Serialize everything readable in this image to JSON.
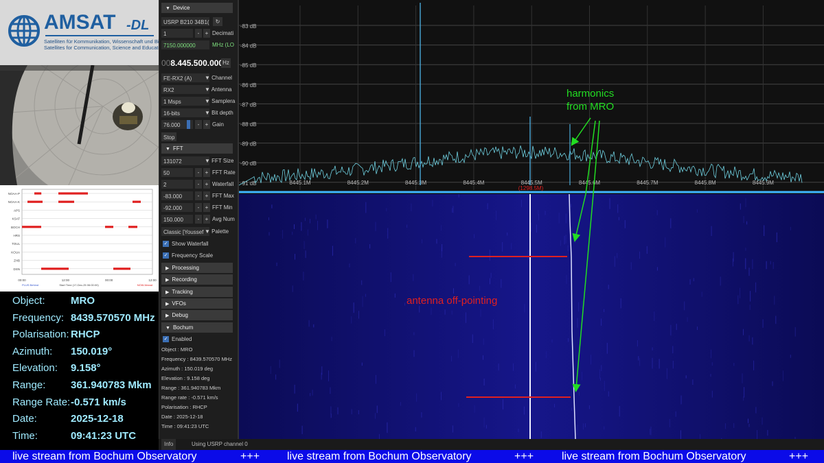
{
  "logo": {
    "name": "AMSAT",
    "suffix": "-DL",
    "tagline_de": "Satelliten für Kommunikation, Wissenschaft und Bildung",
    "tagline_en": "Satellites for Communication, Science and Education",
    "color": "#1f5fa0"
  },
  "schedule": {
    "rows": [
      "NOAA-P",
      "NOAA-K",
      "APS",
      "KSAT",
      "BOCH",
      "HRS",
      "TOUL",
      "KOUA",
      "ZHB",
      "DSN"
    ],
    "x_ticks": [
      "00:00",
      "12:00",
      "00:00",
      "12:00"
    ],
    "footer_left": "PLUS Behind",
    "footer_mid": "Start Time (17-Dec-25 06:00:00)",
    "footer_right": "NOW Ahead"
  },
  "object_info": [
    {
      "label": "Object:",
      "value": "MRO"
    },
    {
      "label": "Frequency:",
      "value": "8439.570570 MHz"
    },
    {
      "label": "Polarisation:",
      "value": "RHCP"
    },
    {
      "label": "Azimuth:",
      "value": "150.019°"
    },
    {
      "label": "Elevation:",
      "value": "9.158°"
    },
    {
      "label": "Range:",
      "value": "361.940783 Mkm"
    },
    {
      "label": "Range Rate:",
      "value": "-0.571 km/s"
    },
    {
      "label": "Date:",
      "value": "2025-12-18"
    },
    {
      "label": "Time:",
      "value": "09:41:23 UTC"
    }
  ],
  "sidebar": {
    "device_header": "Device",
    "device_name": "USRP B210 34B1(",
    "decimation_value": "1",
    "decimation_label": "Decimati",
    "lo_value": "7150.000000",
    "lo_label": "MHz (LO",
    "frequency_prefix": "00",
    "frequency": "8.445.500.000",
    "frequency_unit": "Hz",
    "channel_value": "FE-RX2 (A)",
    "channel_label": "Channel",
    "antenna_value": "RX2",
    "antenna_label": "Antenna",
    "samplerate_value": "1 Msps",
    "samplerate_label": "Samplera",
    "bitdepth_value": "16-bits",
    "bitdepth_label": "Bit depth",
    "gain_value": "76.000",
    "gain_label": "Gain",
    "stop_label": "Stop",
    "fft_header": "FFT",
    "fft_size_value": "131072",
    "fft_size_label": "FFT Size",
    "fft_rate_value": "50",
    "fft_rate_label": "FFT Rate",
    "waterfall_value": "2",
    "waterfall_label": "Waterfall",
    "fft_max_value": "-83.000",
    "fft_max_label": "FFT Max",
    "fft_min_value": "-92.000",
    "fft_min_label": "FFT Min",
    "avg_value": "150.000",
    "avg_label": "Avg Num",
    "palette_value": "Classic [Youssef",
    "palette_label": "Palette",
    "show_waterfall": "Show Waterfall",
    "frequency_scale": "Frequency Scale",
    "processing": "Processing",
    "recording": "Recording",
    "tracking": "Tracking",
    "vfos": "VFOs",
    "debug": "Debug",
    "bochum": "Bochum",
    "enabled": "Enabled",
    "bochum_lines": [
      "Object : MRO",
      "Frequency : 8439.570570 MHz",
      "Azimuth : 150.019 deg",
      "Elevation : 9.158 deg",
      "Range : 361.940783 Mkm",
      "Range rate : -0.571 km/s",
      "Polarisation : RHCP",
      "Date : 2025-12-18",
      "Time : 09:41:23 UTC"
    ]
  },
  "info_bar": {
    "tab": "Info",
    "status": "Using USRP channel 0"
  },
  "spectrum": {
    "db_labels": [
      "-83 dB",
      "-84 dB",
      "-85 dB",
      "-86 dB",
      "-87 dB",
      "-88 dB",
      "-89 dB",
      "-90 dB",
      "-91 dB"
    ],
    "freq_labels": [
      "8445.1M",
      "8445.2M",
      "8445.3M",
      "8445.4M",
      "8445.5M",
      "8445.6M",
      "8445.7M",
      "8445.8M",
      "8445.9M"
    ],
    "center_label": "(1298.5M)",
    "trace_color": "#6fd0e0",
    "accent_color": "#4aa8d8"
  },
  "annotations": {
    "harmonics_line1": "harmonics",
    "harmonics_line2": "from MRO",
    "offpointing": "antenna off-pointing",
    "green": "#22dd22",
    "red": "#e02020"
  },
  "ticker": {
    "text": "live stream from Bochum Observatory",
    "sep": "+++",
    "color": "#0b0be8"
  }
}
